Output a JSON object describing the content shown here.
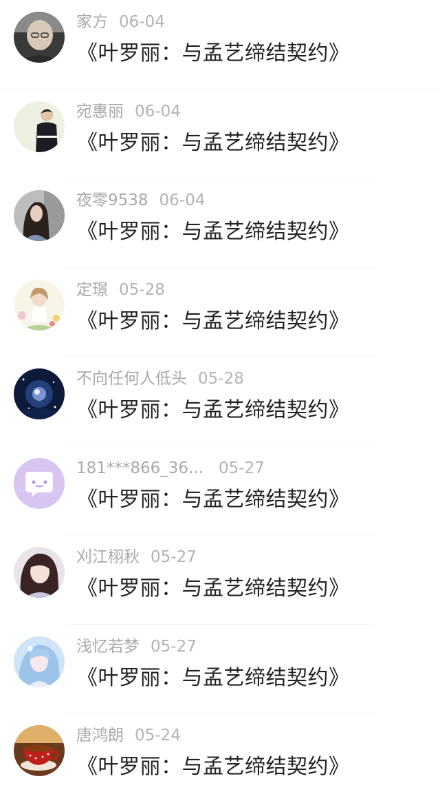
{
  "comments": [
    {
      "user": "家方",
      "date": "06-04",
      "title": "《叶罗丽：与孟艺缔结契约》",
      "avatar": "elderly-man-avatar"
    },
    {
      "user": "宛惠丽",
      "date": "06-04",
      "title": "《叶罗丽：与孟艺缔结契约》",
      "avatar": "boy-black-jacket-avatar"
    },
    {
      "user": "夜零9538",
      "date": "06-04",
      "title": "《叶罗丽：与孟艺缔结契约》",
      "avatar": "long-hair-girl-avatar"
    },
    {
      "user": "定璟",
      "date": "05-28",
      "title": "《叶罗丽：与孟艺缔结契约》",
      "avatar": "anime-flower-girl-avatar"
    },
    {
      "user": "不向任何人低头",
      "date": "05-28",
      "title": "《叶罗丽：与孟艺缔结契约》",
      "avatar": "galaxy-avatar"
    },
    {
      "user": "181***866_36...",
      "date": "05-27",
      "title": "《叶罗丽：与孟艺缔结契约》",
      "avatar": "default-chat-bubble-avatar"
    },
    {
      "user": "刈江栩秋",
      "date": "05-27",
      "title": "《叶罗丽：与孟艺缔结契约》",
      "avatar": "anime-dark-hair-girl-avatar"
    },
    {
      "user": "浅忆若梦",
      "date": "05-27",
      "title": "《叶罗丽：与孟艺缔结契约》",
      "avatar": "anime-blue-doll-avatar"
    },
    {
      "user": "唐鸿朗",
      "date": "05-24",
      "title": "《叶罗丽：与孟艺缔结契约》",
      "avatar": "red-teacup-avatar"
    }
  ],
  "colors": {
    "username": "#a9a9a9",
    "date": "#b3b3b3",
    "title": "#222222",
    "divider": "#f2f2f2",
    "default_avatar_bg": "#d9c5f2"
  }
}
